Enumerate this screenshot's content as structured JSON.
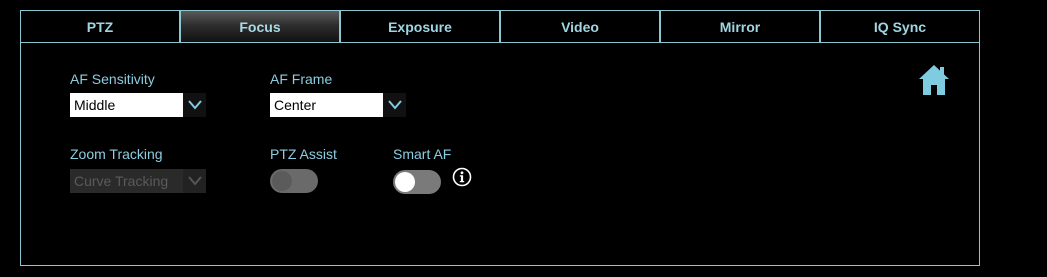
{
  "tabs": [
    {
      "label": "PTZ"
    },
    {
      "label": "Focus"
    },
    {
      "label": "Exposure"
    },
    {
      "label": "Video"
    },
    {
      "label": "Mirror"
    },
    {
      "label": "IQ Sync"
    }
  ],
  "active_tab": "Focus",
  "focus": {
    "af_sensitivity": {
      "label": "AF Sensitivity",
      "value": "Middle",
      "enabled": true
    },
    "af_frame": {
      "label": "AF Frame",
      "value": "Center",
      "enabled": true
    },
    "zoom_tracking": {
      "label": "Zoom Tracking",
      "value": "Curve Tracking",
      "enabled": false
    },
    "ptz_assist": {
      "label": "PTZ Assist",
      "state": "off",
      "enabled": false
    },
    "smart_af": {
      "label": "Smart AF",
      "state": "off",
      "enabled": true
    }
  },
  "icons": {
    "home": "home-icon",
    "info": "info-icon",
    "dropdown": "chevron-down-icon"
  },
  "colors": {
    "accent": "#8cc6d2",
    "label": "#8ccde0",
    "background": "#000000",
    "home_icon": "#7fcbe0"
  }
}
